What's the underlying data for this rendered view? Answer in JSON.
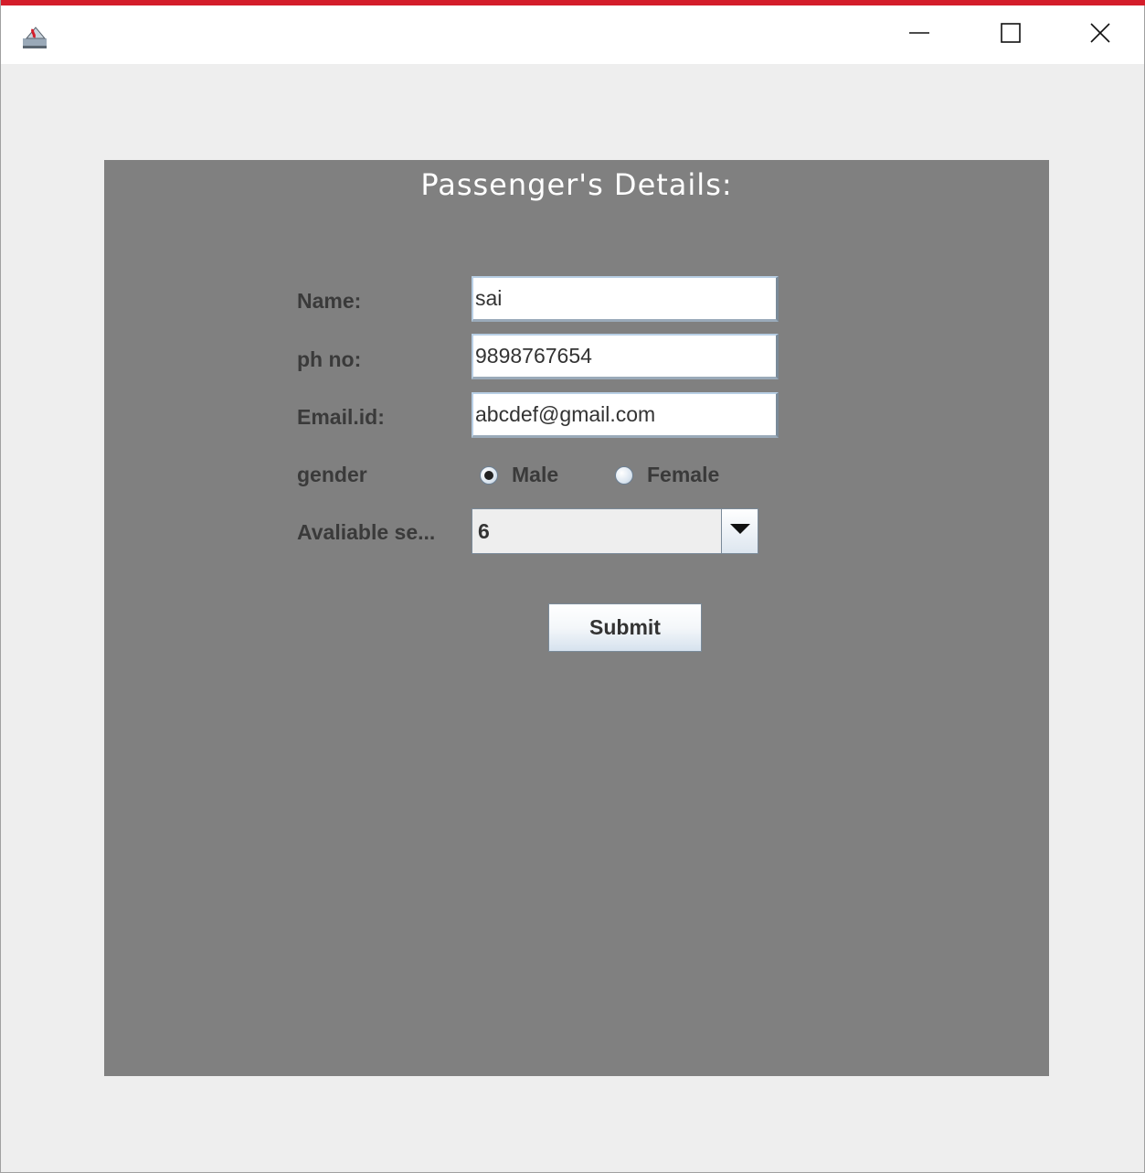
{
  "window": {
    "accent_color": "#d41d2a",
    "icons": {
      "app": "java-app-icon",
      "minimize": "minimize-icon",
      "maximize": "maximize-icon",
      "close": "close-icon"
    }
  },
  "form": {
    "heading": "Passenger's Details:",
    "panel_color": "#808080",
    "name": {
      "label": "Name:",
      "value": "sai"
    },
    "phone": {
      "label": "ph no:",
      "value": "9898767654"
    },
    "email": {
      "label": "Email.id:",
      "value": "abcdef@gmail.com"
    },
    "gender": {
      "label": "gender",
      "options": [
        {
          "label": "Male",
          "selected": true
        },
        {
          "label": "Female",
          "selected": false
        }
      ]
    },
    "seats": {
      "label": "Avaliable se...",
      "selected_value": "6"
    },
    "submit_label": "Submit"
  }
}
